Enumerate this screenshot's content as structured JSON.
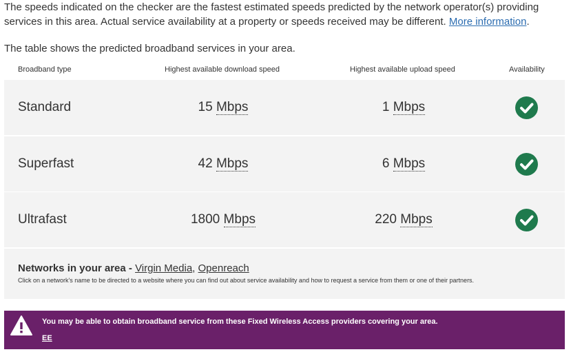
{
  "intro": {
    "text": "The speeds indicated on the checker are the fastest estimated speeds predicted by the network operator(s) providing services in this area. Actual service availability at a property or speeds received may be different.",
    "link": "More information",
    "after_link": "."
  },
  "table_intro": "The table shows the predicted broadband services in your area.",
  "columns": {
    "type": "Broadband type",
    "download": "Highest available download speed",
    "upload": "Highest available upload speed",
    "availability": "Availability"
  },
  "rows": [
    {
      "type": "Standard",
      "download": "15",
      "upload": "1",
      "unit": "Mbps",
      "available": true
    },
    {
      "type": "Superfast",
      "download": "42",
      "upload": "6",
      "unit": "Mbps",
      "available": true
    },
    {
      "type": "Ultrafast",
      "download": "1800",
      "upload": "220",
      "unit": "Mbps",
      "available": true
    }
  ],
  "networks": {
    "title": "Networks in your area - ",
    "items": [
      "Virgin Media",
      "Openreach"
    ],
    "separator": ", ",
    "note": "Click on a network's name to be directed to a website where you can find out about service availability and how to request a service from them or one of their partners."
  },
  "alert": {
    "message": "You may be able to obtain broadband service from these Fixed Wireless Access providers covering your area.",
    "provider": "EE"
  },
  "colors": {
    "check": "#1f7a4d",
    "alert_bg": "#6a2069",
    "row_bg": "#f3f3f3"
  }
}
